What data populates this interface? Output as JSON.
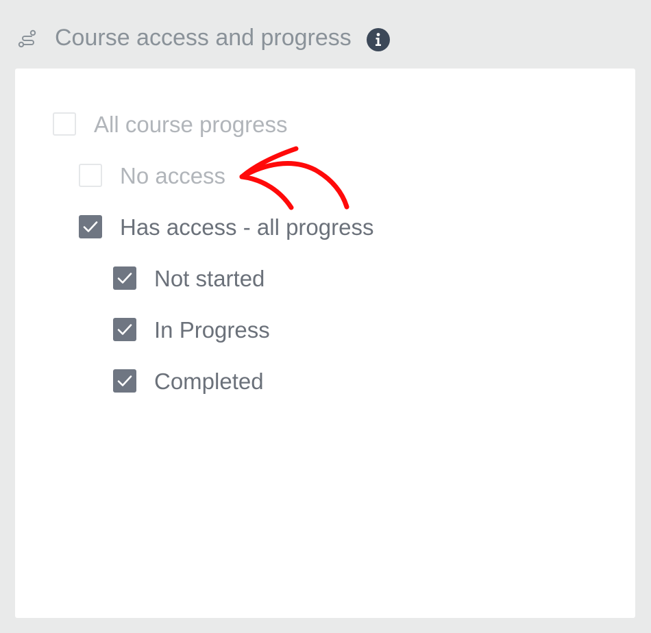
{
  "header": {
    "title": "Course access and progress",
    "route_icon": "route-icon",
    "info_icon": "info-icon"
  },
  "options": {
    "all_course_progress": {
      "label": "All course progress",
      "checked": false,
      "disabled": true
    },
    "no_access": {
      "label": "No access",
      "checked": false,
      "disabled": true
    },
    "has_access_all_progress": {
      "label": "Has access - all progress",
      "checked": true,
      "disabled": false
    },
    "not_started": {
      "label": "Not started",
      "checked": true,
      "disabled": false
    },
    "in_progress": {
      "label": "In Progress",
      "checked": true,
      "disabled": false
    },
    "completed": {
      "label": "Completed",
      "checked": true,
      "disabled": false
    }
  },
  "annotation": {
    "type": "arrow-icon",
    "color": "#ff0000",
    "points_to": "no_access"
  },
  "colors": {
    "background": "#e9eaea",
    "panel": "#ffffff",
    "checkbox_checked": "#6f7682",
    "label_disabled": "#b1b5ba",
    "label_enabled": "#6b717a",
    "title": "#8a9299",
    "info_icon": "#3c4858"
  }
}
